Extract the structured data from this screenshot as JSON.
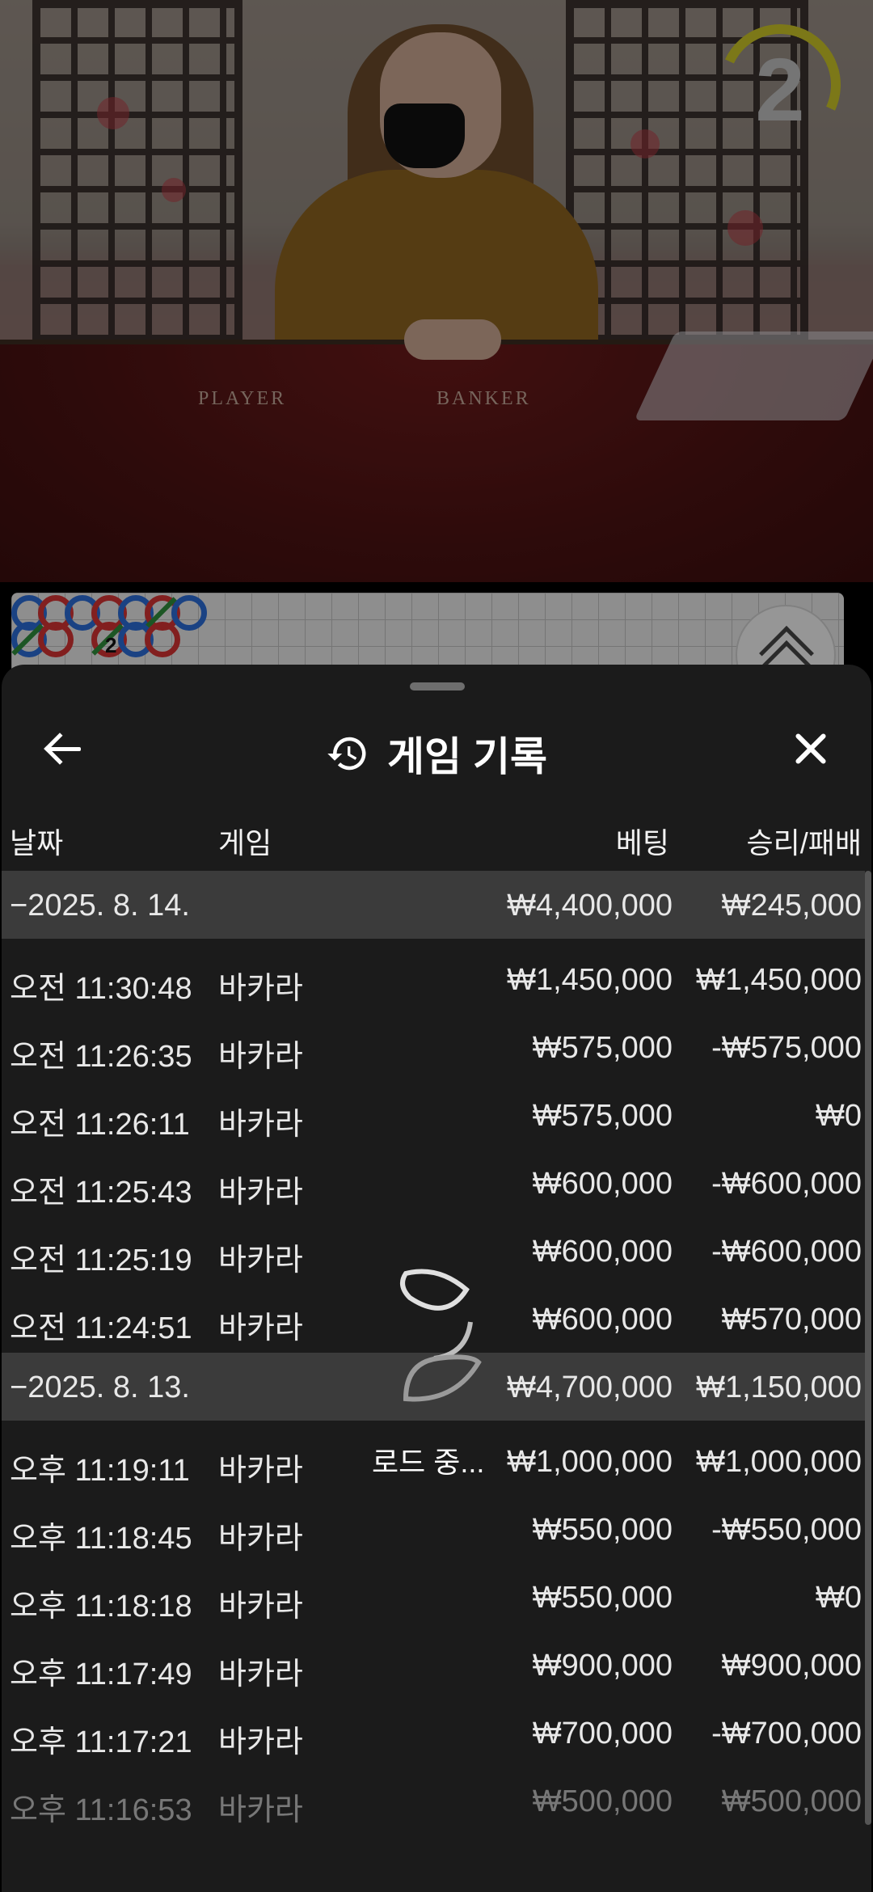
{
  "stream": {
    "countdown": "2",
    "table_labels": {
      "player": "PLAYER",
      "banker": "BANKER"
    }
  },
  "history": {
    "title": "게임 기록",
    "columns": {
      "date": "날짜",
      "game": "게임",
      "bet": "베팅",
      "result": "승리/패배"
    },
    "groups": [
      {
        "date": "−2025. 8. 14.",
        "bet_total": "₩4,400,000",
        "result_total": "₩245,000",
        "rows": [
          {
            "time": "오전 11:30:48",
            "game": "바카라",
            "bet": "₩1,450,000",
            "result": "₩1,450,000"
          },
          {
            "time": "오전 11:26:35",
            "game": "바카라",
            "bet": "₩575,000",
            "result": "-₩575,000"
          },
          {
            "time": "오전 11:26:11",
            "game": "바카라",
            "bet": "₩575,000",
            "result": "₩0"
          },
          {
            "time": "오전 11:25:43",
            "game": "바카라",
            "bet": "₩600,000",
            "result": "-₩600,000"
          },
          {
            "time": "오전 11:25:19",
            "game": "바카라",
            "bet": "₩600,000",
            "result": "-₩600,000"
          },
          {
            "time": "오전 11:24:51",
            "game": "바카라",
            "bet": "₩600,000",
            "result": "₩570,000"
          }
        ]
      },
      {
        "date": "−2025. 8. 13.",
        "bet_total": "₩4,700,000",
        "result_total": "₩1,150,000",
        "rows": [
          {
            "time": "오후 11:19:11",
            "game": "바카라",
            "bet": "₩1,000,000",
            "result": "₩1,000,000"
          },
          {
            "time": "오후 11:18:45",
            "game": "바카라",
            "bet": "₩550,000",
            "result": "-₩550,000"
          },
          {
            "time": "오후 11:18:18",
            "game": "바카라",
            "bet": "₩550,000",
            "result": "₩0"
          },
          {
            "time": "오후 11:17:49",
            "game": "바카라",
            "bet": "₩900,000",
            "result": "₩900,000"
          },
          {
            "time": "오후 11:17:21",
            "game": "바카라",
            "bet": "₩700,000",
            "result": "-₩700,000"
          },
          {
            "time": "오후 11:16:53",
            "game": "바카라",
            "bet": "₩500,000",
            "result": "₩500,000"
          }
        ]
      }
    ],
    "loading_text": "로드 중..."
  },
  "icons": {
    "back": "arrow-left-icon",
    "history": "history-clock-icon",
    "close": "close-icon",
    "road_scroll": "chevron-up-icon"
  },
  "colors": {
    "sheet_bg": "#1b1b1b",
    "group_bg": "#3b3b3b",
    "timer_ring": "#c9c228",
    "banker_red": "#d23232",
    "player_blue": "#2a6bd4",
    "tie_green": "#2e8b3a"
  }
}
